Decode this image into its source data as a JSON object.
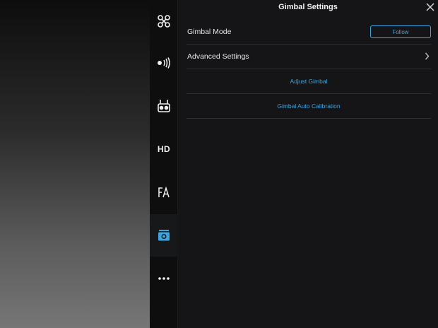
{
  "panel": {
    "title": "Gimbal Settings",
    "close_icon": "close-icon"
  },
  "tabs": [
    {
      "id": "aircraft",
      "icon": "drone-icon",
      "active": false
    },
    {
      "id": "sensors",
      "icon": "signal-icon",
      "active": false
    },
    {
      "id": "remote-controller",
      "icon": "remote-controller-icon",
      "active": false
    },
    {
      "id": "hd",
      "icon": "hd-icon",
      "label": "HD",
      "active": false
    },
    {
      "id": "battery",
      "icon": "battery-icon",
      "active": false
    },
    {
      "id": "gimbal",
      "icon": "gimbal-camera-icon",
      "active": true
    },
    {
      "id": "more",
      "icon": "more-icon",
      "active": false
    }
  ],
  "rows": {
    "gimbal_mode": {
      "label": "Gimbal Mode",
      "value": "Follow"
    },
    "advanced": {
      "label": "Advanced Settings"
    },
    "adjust": {
      "label": "Adjust Gimbal"
    },
    "calibration": {
      "label": "Gimbal Auto Calibration"
    }
  },
  "colors": {
    "accent": "#3da4e0",
    "panel_bg": "#151517",
    "divider": "#2f3033"
  }
}
